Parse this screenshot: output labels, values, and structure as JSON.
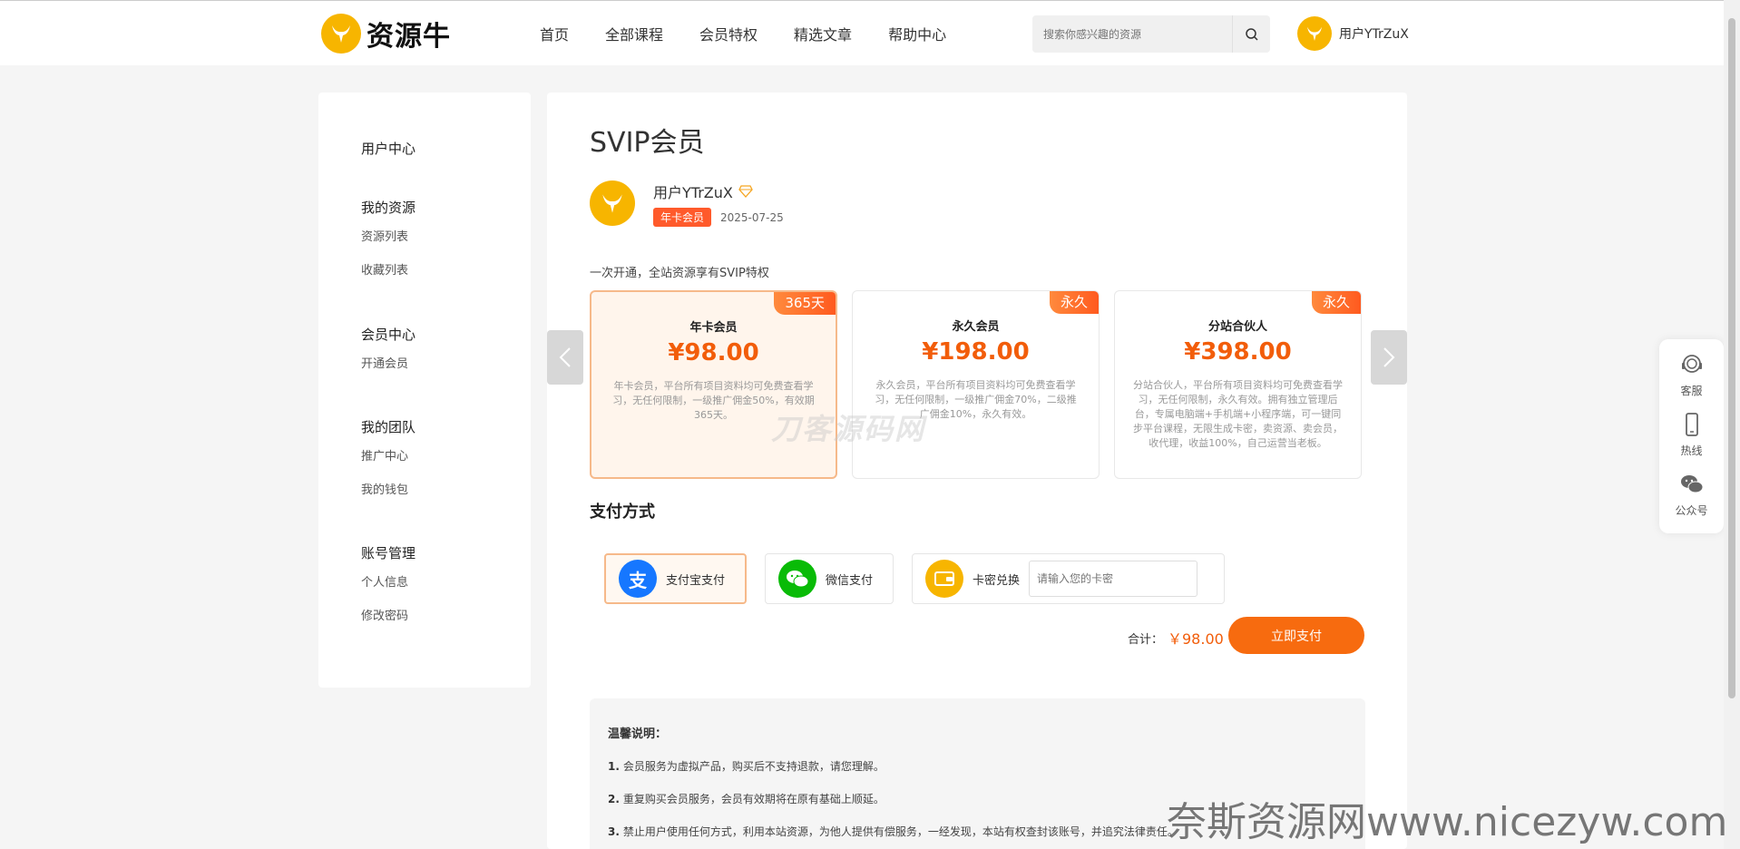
{
  "header": {
    "logo_text": "资源牛",
    "nav": [
      "首页",
      "全部课程",
      "会员特权",
      "精选文章",
      "帮助中心"
    ],
    "search_placeholder": "搜索你感兴趣的资源",
    "username": "用户YTrZuX"
  },
  "sidebar": {
    "groups": [
      {
        "title": "用户中心",
        "links": []
      },
      {
        "title": "我的资源",
        "links": [
          "资源列表",
          "收藏列表"
        ]
      },
      {
        "title": "会员中心",
        "links": [
          "开通会员"
        ]
      },
      {
        "title": "我的团队",
        "links": [
          "推广中心",
          "我的钱包"
        ]
      },
      {
        "title": "账号管理",
        "links": [
          "个人信息",
          "修改密码"
        ]
      }
    ]
  },
  "main": {
    "title": "SVIP会员",
    "profile": {
      "name": "用户YTrZuX",
      "badge": "年卡会员",
      "date": "2025-07-25"
    },
    "intro": "一次开通，全站资源享有SVIP特权",
    "plans": [
      {
        "tag": "365天",
        "name": "年卡会员",
        "price": "¥98.00",
        "desc": "年卡会员，平台所有项目资料均可免费查看学习，无任何限制，一级推广佣金50%，有效期365天。",
        "selected": true
      },
      {
        "tag": "永久",
        "name": "永久会员",
        "price": "¥198.00",
        "desc": "永久会员，平台所有项目资料均可免费查看学习，无任何限制，一级推广佣金70%，二级推广佣金10%，永久有效。",
        "selected": false
      },
      {
        "tag": "永久",
        "name": "分站合伙人",
        "price": "¥398.00",
        "desc": "分站合伙人，平台所有项目资料均可免费查看学习，无任何限制，永久有效。拥有独立管理后台，专属电脑端+手机端+小程序端，可一键同步平台课程，无限生成卡密，卖资源、卖会员，收代理，收益100%，自己运营当老板。",
        "selected": false
      }
    ],
    "pay_title": "支付方式",
    "pay_options": {
      "alipay": "支付宝支付",
      "wechat": "微信支付",
      "card": "卡密兑换",
      "card_placeholder": "请输入您的卡密"
    },
    "total_label": "合计：",
    "total_value": "￥98.00",
    "pay_button": "立即支付",
    "notice": {
      "title": "温馨说明：",
      "items": [
        {
          "num": "1.",
          "text": "会员服务为虚拟产品，购买后不支持退款，请您理解。"
        },
        {
          "num": "2.",
          "text": "重复购买会员服务，会员有效期将在原有基础上顺延。"
        },
        {
          "num": "3.",
          "text": "禁止用户使用任何方式，利用本站资源，为他人提供有偿服务，一经发现，本站有权查封该账号，并追究法律责任。"
        }
      ]
    },
    "watermark": "刀客源码网"
  },
  "float_bar": [
    "客服",
    "热线",
    "公众号"
  ],
  "site_watermark": "奈斯资源网www.nicezyw.com",
  "colors": {
    "accent": "#f76b0f",
    "brand_yellow": "#f7b500",
    "price": "#f25d0a"
  }
}
